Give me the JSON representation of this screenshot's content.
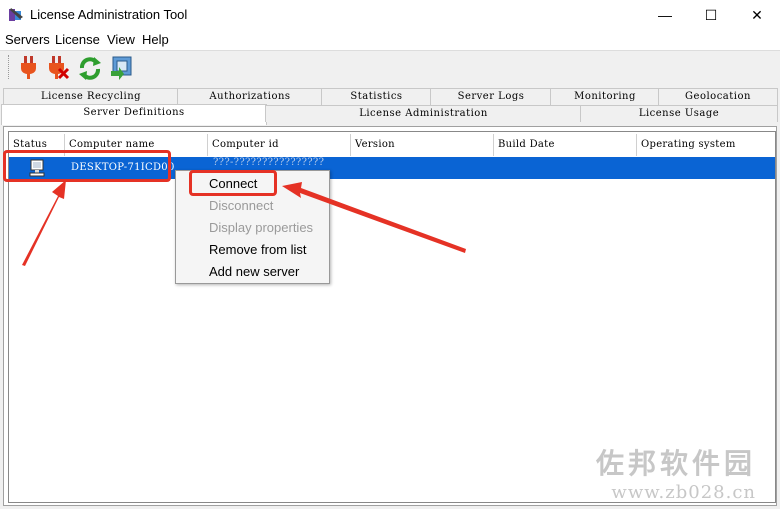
{
  "window": {
    "title": "License Administration Tool",
    "controls": {
      "minimize": "—",
      "maximize": "☐",
      "close": "✕"
    }
  },
  "menubar": [
    "Servers",
    "License",
    "View",
    "Help"
  ],
  "toolbar": {
    "buttons": [
      "connect-icon",
      "disconnect-icon",
      "refresh-icon",
      "server-properties-icon"
    ]
  },
  "tabs": {
    "row1": [
      "License Recycling",
      "Authorizations",
      "Statistics",
      "Server Logs",
      "Monitoring",
      "Geolocation"
    ],
    "row2": [
      "Server Definitions",
      "License Administration",
      "License Usage"
    ],
    "active": "Server Definitions"
  },
  "table": {
    "columns": [
      "Status",
      "Computer name",
      "Computer id",
      "Version",
      "Build Date",
      "Operating system"
    ],
    "rows": [
      {
        "computer_name": "DESKTOP-71ICD00",
        "computer_id": "???-????????????????"
      }
    ]
  },
  "context_menu": {
    "items": [
      {
        "label": "Connect",
        "enabled": true
      },
      {
        "label": "Disconnect",
        "enabled": false
      },
      {
        "label": "Display properties",
        "enabled": false
      },
      {
        "label": "Remove from list",
        "enabled": true
      },
      {
        "label": "Add new server",
        "enabled": true
      }
    ]
  },
  "watermark": {
    "line1": "佐邦软件园",
    "line2": "www.zb028.cn"
  },
  "colors": {
    "selection": "#0a64d4",
    "annotation": "#e53225"
  }
}
